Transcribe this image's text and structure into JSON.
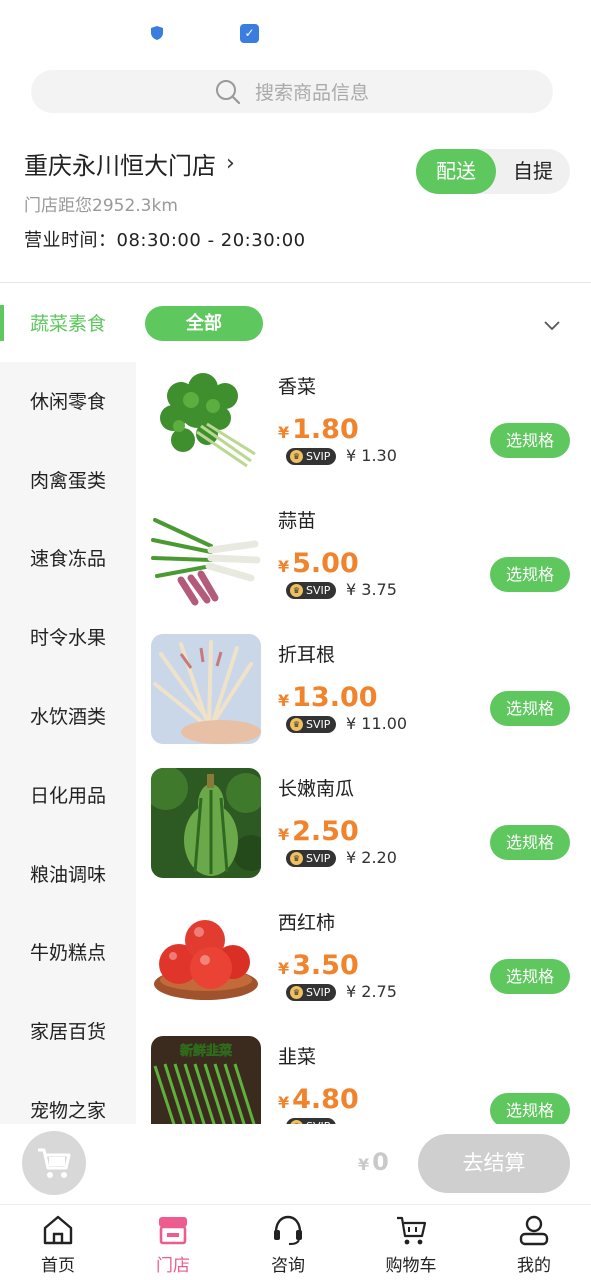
{
  "search": {
    "placeholder": "搜索商品信息"
  },
  "store": {
    "name": "重庆永川恒大门店",
    "distance": "门店距您2952.3km",
    "hours": "营业时间：08:30:00 - 20:30:00"
  },
  "delivery_mode": {
    "options": [
      "配送",
      "自提"
    ],
    "selected": "配送"
  },
  "category": {
    "active": "蔬菜素食",
    "filter_chip": "全部",
    "sidebar": [
      "休闲零食",
      "肉禽蛋类",
      "速食冻品",
      "时令水果",
      "水饮酒类",
      "日化用品",
      "粮油调味",
      "牛奶糕点",
      "家居百货",
      "宠物之家"
    ]
  },
  "currency_symbol": "¥",
  "svip_label": "SVIP",
  "spec_button_label": "选规格",
  "products": [
    {
      "name": "香菜",
      "price": "1.80",
      "svip_price": "¥ 1.30",
      "image": "coriander"
    },
    {
      "name": "蒜苗",
      "price": "5.00",
      "svip_price": "¥ 3.75",
      "image": "garlic-sprouts"
    },
    {
      "name": "折耳根",
      "price": "13.00",
      "svip_price": "¥ 11.00",
      "image": "houttuynia-root"
    },
    {
      "name": "长嫩南瓜",
      "price": "2.50",
      "svip_price": "¥ 2.20",
      "image": "long-squash"
    },
    {
      "name": "西红柿",
      "price": "3.50",
      "svip_price": "¥ 2.75",
      "image": "tomatoes"
    },
    {
      "name": "韭菜",
      "price": "4.80",
      "svip_price": "",
      "image": "chives",
      "image_caption": "新鲜韭菜"
    }
  ],
  "cart": {
    "total": "0",
    "checkout_label": "去结算"
  },
  "tabbar": [
    {
      "label": "首页",
      "icon": "home-icon",
      "active": false
    },
    {
      "label": "门店",
      "icon": "store-icon",
      "active": true
    },
    {
      "label": "咨询",
      "icon": "headset-icon",
      "active": false
    },
    {
      "label": "购物车",
      "icon": "cart-icon",
      "active": false
    },
    {
      "label": "我的",
      "icon": "user-icon",
      "active": false
    }
  ],
  "colors": {
    "accent": "#5ec85e",
    "price": "#f0832b",
    "active_tab": "#ee5b8f"
  }
}
